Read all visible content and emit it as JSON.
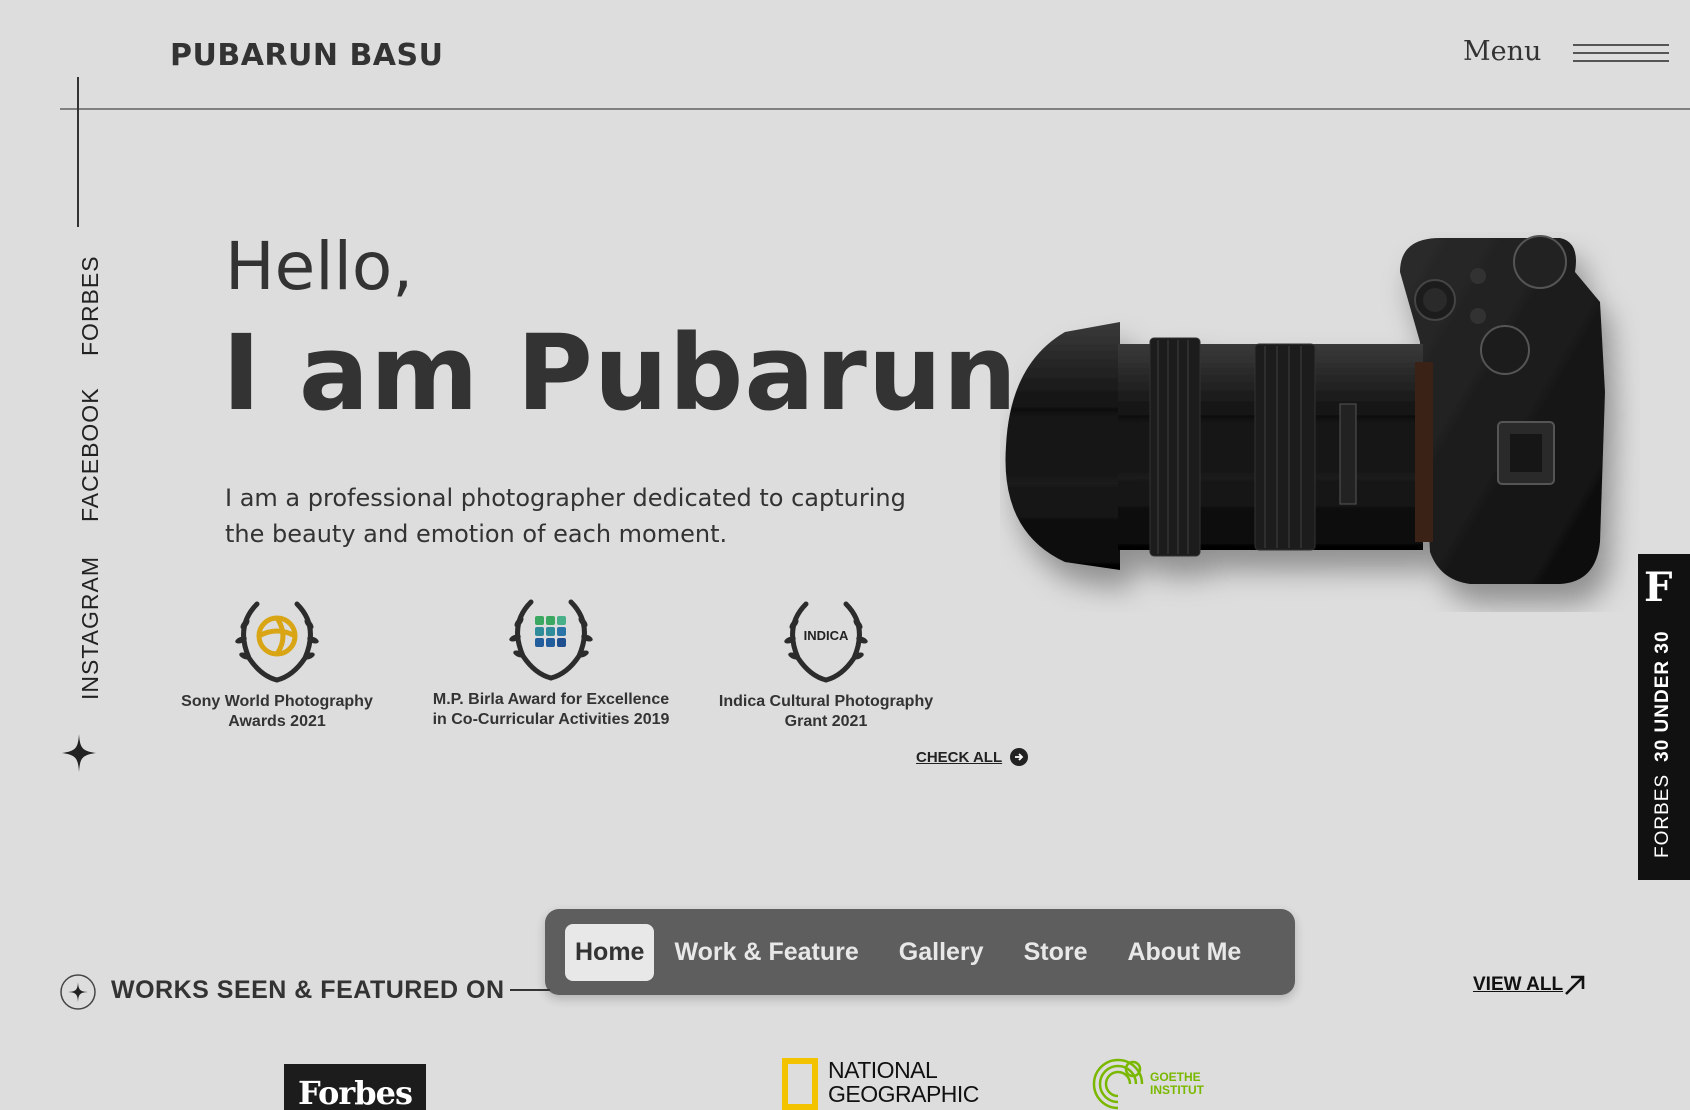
{
  "header": {
    "brand": "PUBARUN BASU",
    "menu_label": "Menu"
  },
  "social": [
    "FORBES",
    "FACEBOOK",
    "INSTAGRAM"
  ],
  "hero": {
    "greeting": "Hello,",
    "headline": "I am Pubarun.",
    "intro": "I am a professional photographer dedicated to capturing the beauty and emotion of each moment."
  },
  "awards": [
    {
      "caption": "Sony World Photography Awards 2021",
      "emblem": "sony-swirl"
    },
    {
      "caption": "M.P. Birla Award for Excellence in Co-Curricular Activities 2019",
      "emblem": "birla-grid"
    },
    {
      "caption": "Indica Cultural Photography Grant 2021",
      "emblem": "indica",
      "emblem_text": "INDICA"
    }
  ],
  "check_all": "CHECK ALL",
  "forbes_badge": {
    "logo": "F",
    "prefix": "FORBES",
    "title": "30 UNDER 30"
  },
  "nav": {
    "items": [
      "Home",
      "Work & Feature",
      "Gallery",
      "Store",
      "About Me"
    ],
    "active": "Home"
  },
  "featured": {
    "title": "WORKS SEEN & FEATURED ON",
    "view_all": "VIEW ALL"
  },
  "logos": {
    "forbes": "Forbes",
    "natgeo_line1": "NATIONAL",
    "natgeo_line2": "GEOGRAPHIC",
    "goethe_line1": "GOETHE",
    "goethe_line2": "INSTITUT"
  },
  "colors": {
    "background": "#dddddd",
    "text": "#333333",
    "nav_bg": "#5e5e5e",
    "natgeo_yellow": "#f3c300",
    "goethe_green": "#7ab800",
    "sony_gold": "#d9a514"
  }
}
